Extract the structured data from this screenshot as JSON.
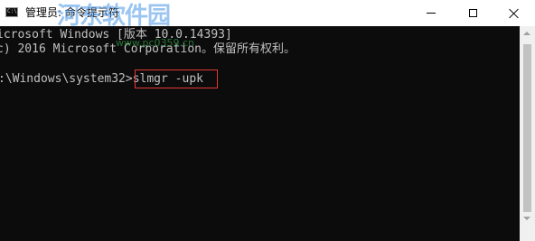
{
  "window": {
    "title": "管理员: 命令提示符",
    "watermark": "河东软件园",
    "watermark_url": "www.pc0359.cn"
  },
  "console": {
    "lines": [
      "icrosoft Windows [版本 10.0.14393]",
      "c) 2016 Microsoft Corporation。保留所有权利。",
      ":\\Windows\\system32>slmgr -upk"
    ]
  },
  "icons": {
    "app": "cmd-app-icon",
    "minimize": "minimize-icon",
    "maximize": "maximize-icon",
    "close": "close-icon"
  },
  "colors": {
    "console_bg": "#0c0c0c",
    "console_fg": "#c0c0c0",
    "highlight_box": "#e53935",
    "watermark": "#4896e6"
  }
}
